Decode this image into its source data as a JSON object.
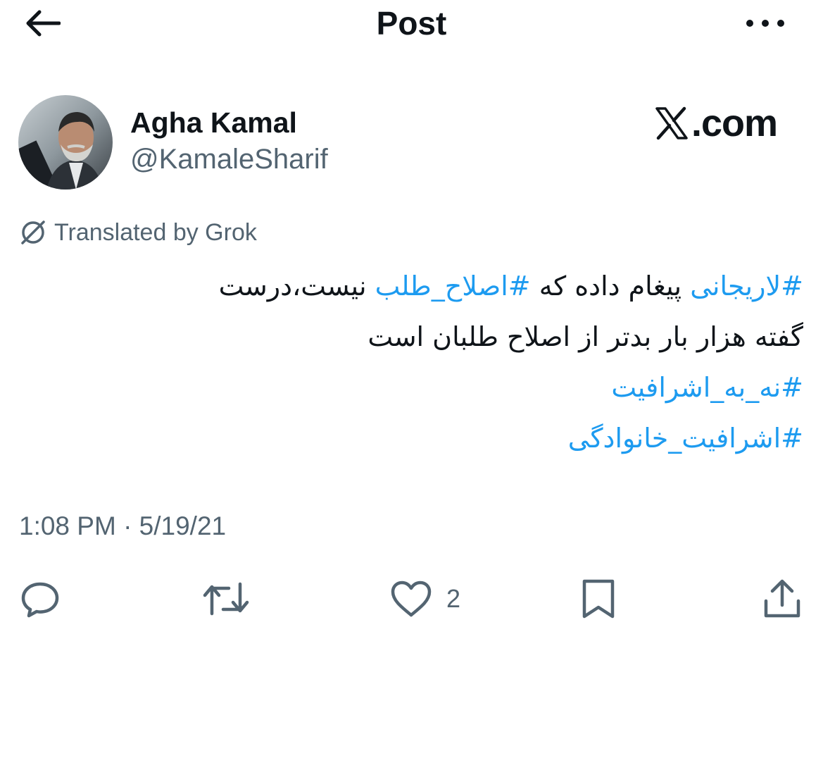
{
  "header": {
    "title": "Post",
    "back_icon": "arrow-left-icon",
    "more_icon": "more-horizontal-icon"
  },
  "author": {
    "display_name": "Agha Kamal",
    "handle": "@KamaleSharif"
  },
  "watermark": {
    "text": ".com",
    "logo_icon": "x-logo-icon"
  },
  "translation": {
    "label": "Translated by Grok",
    "icon": "translate-icon"
  },
  "tweet": {
    "line1": {
      "hashtag1": "#لاریجانی",
      "text1": " پیغام داده که ",
      "hashtag2": "#اصلاح_طلب",
      "text2": " نیست،درست"
    },
    "line2": "گفته هزار بار بدتر از اصلاح طلبان است",
    "hashtag3": "#نه_به_اشرافیت",
    "hashtag4": "#اشرافیت_خانوادگی"
  },
  "timestamp": "1:08 PM · 5/19/21",
  "actions": {
    "reply_icon": "reply-icon",
    "repost_icon": "repost-icon",
    "like_icon": "heart-icon",
    "like_count": "2",
    "bookmark_icon": "bookmark-icon",
    "share_icon": "share-icon"
  },
  "colors": {
    "link": "#1d9bf0",
    "secondary_text": "#536471",
    "primary_text": "#0f1419"
  }
}
